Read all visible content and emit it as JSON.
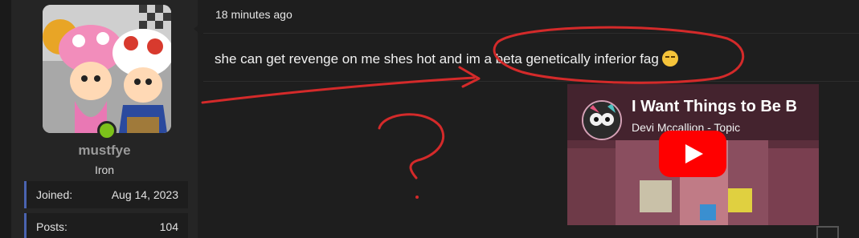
{
  "post": {
    "timestamp": "18 minutes ago",
    "message": "she can get revenge on me shes hot and im a beta genetically inferior fag",
    "emoji_icon": "crying-laughing-emoji-icon"
  },
  "user": {
    "name": "mustfye",
    "rank": "Iron",
    "online": true,
    "stats": [
      {
        "label": "Joined:",
        "value": "Aug 14, 2023"
      },
      {
        "label": "Posts:",
        "value": "104"
      }
    ]
  },
  "video": {
    "title": "I Want Things to Be B",
    "channel": "Devi Mccallion - Topic",
    "play_icon": "play-icon"
  },
  "colors": {
    "accent_border": "#4a63b0",
    "online_green": "#7cc11a",
    "annotation_red": "#d42a2a",
    "youtube_red": "#ff0000"
  }
}
